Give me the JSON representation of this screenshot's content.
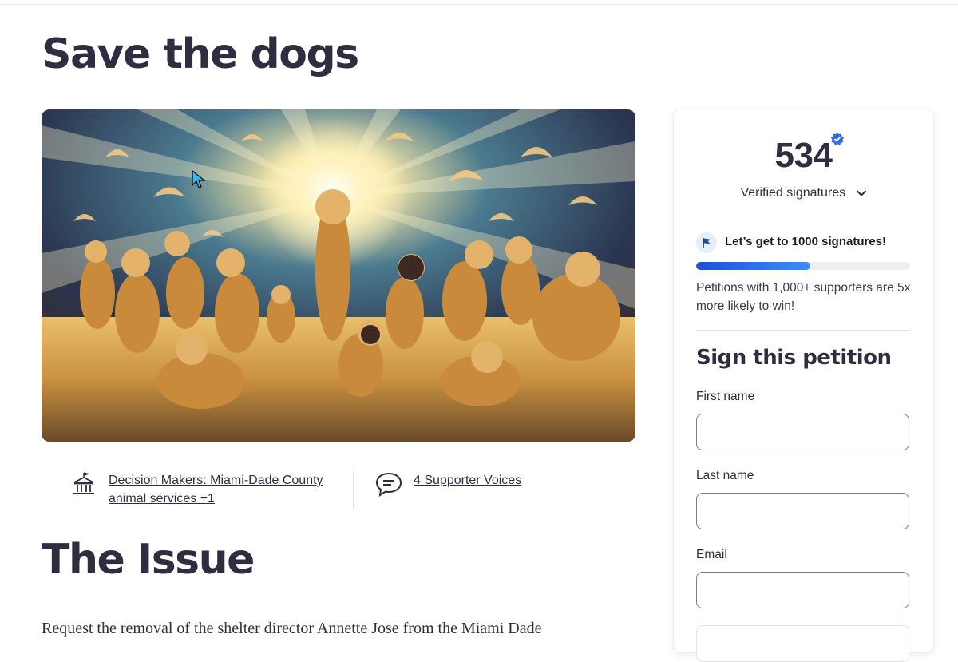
{
  "page": {
    "title": "Save the dogs"
  },
  "hero": {
    "image_name": "dogs-with-doves-illustration"
  },
  "meta": {
    "decision_makers_line1": "Decision Makers: Miami-Dade County",
    "decision_makers_line2": "animal services +1",
    "supporter_voices": "4 Supporter Voices"
  },
  "issue": {
    "heading": "The Issue",
    "text": "Request the removal of the shelter director Annette Jose from the Miami Dade"
  },
  "signatures": {
    "count": "534",
    "label": "Verified signatures",
    "goal_text": "Let’s get to 1000 signatures!",
    "goal_progress": 0.534,
    "goal_description": "Petitions with 1,000+ supporters are 5x more likely to win!"
  },
  "sign_form": {
    "title": "Sign this petition",
    "first_name_label": "First name",
    "first_name_value": "",
    "last_name_label": "Last name",
    "last_name_value": "",
    "email_label": "Email",
    "email_value": ""
  },
  "colors": {
    "text": "#2f2e41",
    "accent_blue": "#1f4fd8",
    "verified_badge": "#2f6fde"
  }
}
